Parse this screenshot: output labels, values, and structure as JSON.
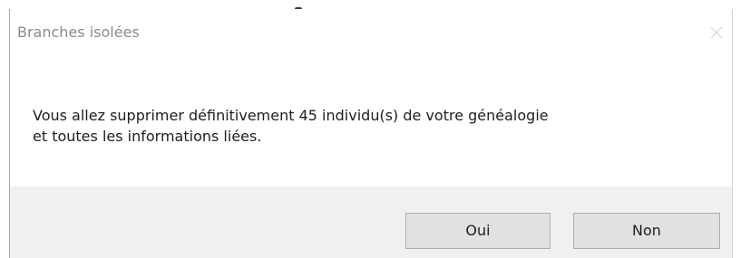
{
  "window": {
    "title": "Branches isolées"
  },
  "message": {
    "line1": "Vous allez supprimer définitivement 45 individu(s) de votre généalogie",
    "line2": "et toutes les informations liées."
  },
  "buttons": {
    "yes_label": "Oui",
    "no_label": "Non"
  },
  "icons": {
    "close": "close-icon"
  },
  "colors": {
    "title_text": "#8a8a8a",
    "footer_bg": "#f0f0f0",
    "button_bg": "#e1e1e1",
    "button_border": "#adadad"
  }
}
